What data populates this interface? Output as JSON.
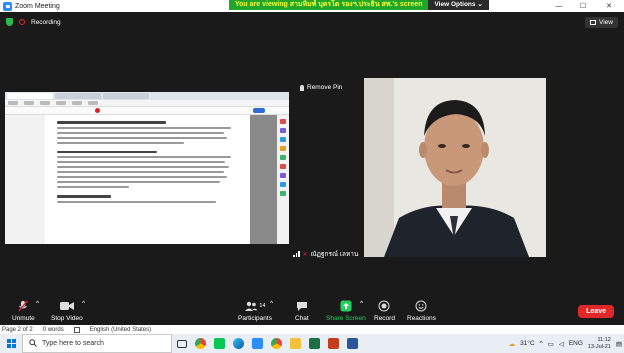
{
  "window": {
    "title": "Zoom Meeting",
    "minimize": "—",
    "maximize": "☐",
    "close": "✕"
  },
  "share_banner": {
    "message": "You are viewing สามหิมพ์ บุตรโด รองฯ.ประธิน สพ.'s screen",
    "view_options": "View Options",
    "caret": "⌄"
  },
  "meeting": {
    "recording": "Recording",
    "view_button": "View",
    "remove_pin": "Remove Pin",
    "participant_name": "ณัฏฐกรณ์ เลหาน"
  },
  "controls": {
    "unmute": "Unmute",
    "stop_video": "Stop Video",
    "participants": "Participants",
    "participants_count": "14",
    "chat": "Chat",
    "share_screen": "Share Screen",
    "record": "Record",
    "reactions": "Reactions",
    "leave": "Leave"
  },
  "word_status": {
    "page": "Page 2 of 2",
    "words": "0 words",
    "language": "English (United States)"
  },
  "taskbar": {
    "search_placeholder": "Type here to search",
    "weather": "31°C",
    "language": "ENG",
    "time": "11:12",
    "date": "13-Jul-21"
  },
  "colors": {
    "accent_green": "#23d160",
    "leave_red": "#e02828",
    "banner_green": "#21a629",
    "banner_text": "#f4ff3a"
  }
}
